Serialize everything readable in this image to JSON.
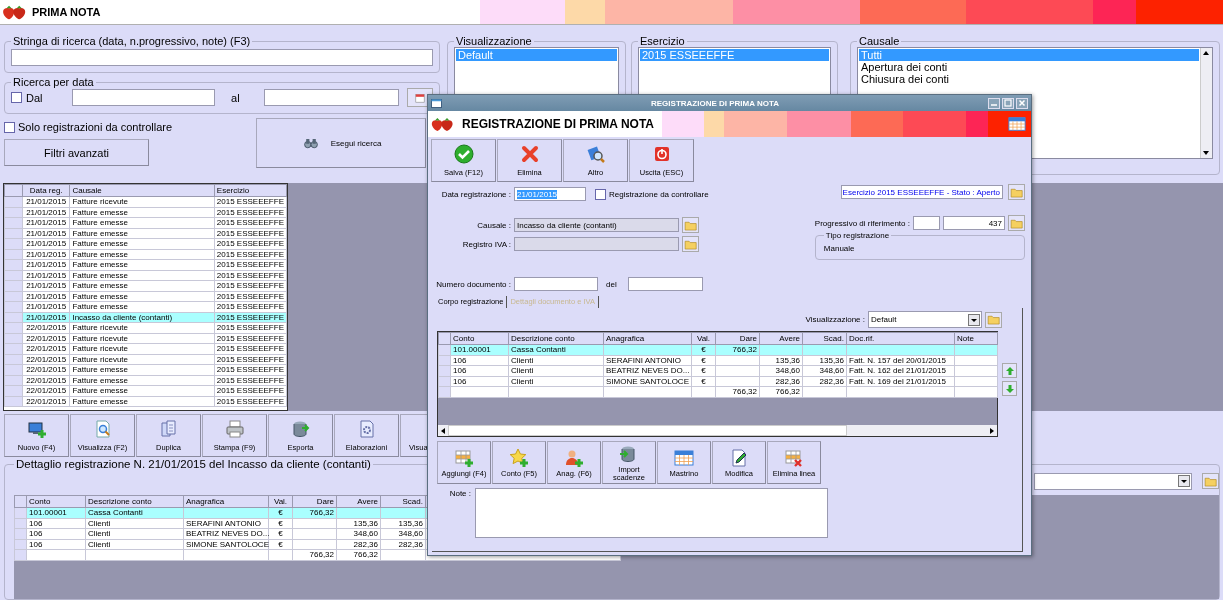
{
  "app": {
    "title": "PRIMA NOTA"
  },
  "search": {
    "legend": "Stringa di ricerca (data, n.progressivo, note) (F3)"
  },
  "date_search": {
    "legend": "Ricerca per data",
    "from_label": "Dal",
    "from_checked": false,
    "to_label": "al"
  },
  "only_to_check": {
    "label": "Solo registrazioni da controllare",
    "checked": false
  },
  "advanced_filters_button": "Filtri avanzati",
  "run_search_button": "Esegui ricerca",
  "view_list": {
    "legend": "Visualizzazione",
    "items": [
      {
        "label": "Default",
        "selected": true
      }
    ]
  },
  "year_list": {
    "legend": "Esercizio",
    "items": [
      {
        "label": "2015 ESSEEEFFE",
        "selected": true
      }
    ]
  },
  "reason_list": {
    "legend": "Causale",
    "items": [
      {
        "label": "Tutti",
        "selected": true
      },
      {
        "label": "Apertura dei conti",
        "selected": false
      },
      {
        "label": "Chiusura dei conti",
        "selected": false
      }
    ]
  },
  "registrations": {
    "columns": [
      "Data reg.",
      "Causale",
      "Esercizio"
    ],
    "rows": [
      {
        "cells": [
          "21/01/2015",
          "Fatture ricevute",
          "2015 ESSEEEFFE"
        ],
        "selected": false
      },
      {
        "cells": [
          "21/01/2015",
          "Fatture emesse",
          "2015 ESSEEEFFE"
        ],
        "selected": false
      },
      {
        "cells": [
          "21/01/2015",
          "Fatture emesse",
          "2015 ESSEEEFFE"
        ],
        "selected": false
      },
      {
        "cells": [
          "21/01/2015",
          "Fatture emesse",
          "2015 ESSEEEFFE"
        ],
        "selected": false
      },
      {
        "cells": [
          "21/01/2015",
          "Fatture emesse",
          "2015 ESSEEEFFE"
        ],
        "selected": false
      },
      {
        "cells": [
          "21/01/2015",
          "Fatture emesse",
          "2015 ESSEEEFFE"
        ],
        "selected": false
      },
      {
        "cells": [
          "21/01/2015",
          "Fatture emesse",
          "2015 ESSEEEFFE"
        ],
        "selected": false
      },
      {
        "cells": [
          "21/01/2015",
          "Fatture emesse",
          "2015 ESSEEEFFE"
        ],
        "selected": false
      },
      {
        "cells": [
          "21/01/2015",
          "Fatture emesse",
          "2015 ESSEEEFFE"
        ],
        "selected": false
      },
      {
        "cells": [
          "21/01/2015",
          "Fatture emesse",
          "2015 ESSEEEFFE"
        ],
        "selected": false
      },
      {
        "cells": [
          "21/01/2015",
          "Fatture emesse",
          "2015 ESSEEEFFE"
        ],
        "selected": false
      },
      {
        "cells": [
          "21/01/2015",
          "Incasso da cliente (contanti)",
          "2015 ESSEEEFFE"
        ],
        "selected": true
      },
      {
        "cells": [
          "22/01/2015",
          "Fatture ricevute",
          "2015 ESSEEEFFE"
        ],
        "selected": false
      },
      {
        "cells": [
          "22/01/2015",
          "Fatture ricevute",
          "2015 ESSEEEFFE"
        ],
        "selected": false
      },
      {
        "cells": [
          "22/01/2015",
          "Fatture ricevute",
          "2015 ESSEEEFFE"
        ],
        "selected": false
      },
      {
        "cells": [
          "22/01/2015",
          "Fatture ricevute",
          "2015 ESSEEEFFE"
        ],
        "selected": false
      },
      {
        "cells": [
          "22/01/2015",
          "Fatture emesse",
          "2015 ESSEEEFFE"
        ],
        "selected": false
      },
      {
        "cells": [
          "22/01/2015",
          "Fatture emesse",
          "2015 ESSEEEFFE"
        ],
        "selected": false
      },
      {
        "cells": [
          "22/01/2015",
          "Fatture emesse",
          "2015 ESSEEEFFE"
        ],
        "selected": false
      },
      {
        "cells": [
          "22/01/2015",
          "Fatture emesse",
          "2015 ESSEEEFFE"
        ],
        "selected": false
      }
    ]
  },
  "toolbar": [
    "Nuovo (F4)",
    "Visualizza (F2)",
    "Duplica",
    "Stampa (F9)",
    "Esporta",
    "Elaborazioni",
    "Visua"
  ],
  "detail": {
    "legend": "Dettaglio registrazione N. 21/01/2015 del Incasso da cliente (contanti)",
    "columns": [
      "Conto",
      "Descrizione conto",
      "Anagrafica",
      "Val.",
      "Dare",
      "Avere",
      "Scad."
    ],
    "rows": [
      {
        "cells": [
          "101.00001",
          "Cassa Contanti",
          null,
          "€",
          "766,32",
          null,
          null
        ],
        "selected": true
      },
      {
        "cells": [
          "106",
          "Clienti",
          "SERAFINI ANTONIO",
          "€",
          null,
          "135,36",
          "135,36"
        ],
        "selected": false
      },
      {
        "cells": [
          "106",
          "Clienti",
          "BEATRIZ NEVES DO...",
          "€",
          null,
          "348,60",
          "348,60"
        ],
        "selected": false
      },
      {
        "cells": [
          "106",
          "Clienti",
          "SIMONE SANTOLOCE",
          "€",
          null,
          "282,36",
          "282,36"
        ],
        "selected": false
      },
      {
        "cells": [
          null,
          null,
          null,
          null,
          "766,32",
          "766,32",
          null
        ],
        "selected": false
      }
    ]
  },
  "dialog": {
    "window_title": "REGISTRAZIONE DI PRIMA NOTA",
    "header_title": "REGISTRAZIONE DI PRIMA NOTA",
    "actions": [
      "Salva (F12)",
      "Elimina",
      "Altro",
      "Uscita (ESC)"
    ],
    "date": {
      "label": "Data registrazione :",
      "value": "21/01/2015"
    },
    "to_check": {
      "label": "Registrazione da controllare",
      "checked": false
    },
    "year_status": "Esercizio 2015 ESSEEEFFE - Stato : Aperto",
    "causale": {
      "label": "Causale :",
      "value": "Incasso da cliente (contanti)"
    },
    "vat_register": {
      "label": "Registro IVA :"
    },
    "progressive": {
      "label": "Progressivo di riferimento :",
      "value": "437"
    },
    "reg_type": {
      "legend": "Tipo registrazione",
      "value": "Manuale"
    },
    "doc_number": {
      "label": "Numero documento :",
      "date_label": "del"
    },
    "tabs": [
      {
        "label": "Corpo registrazione",
        "selected": true
      },
      {
        "label": "Dettagli documento e IVA",
        "selected": false
      }
    ],
    "view": {
      "label": "Visualizzazione :",
      "value": "Default"
    },
    "columns": [
      "Conto",
      "Descrizione conto",
      "Anagrafica",
      "Val.",
      "Dare",
      "Avere",
      "Scad.",
      "Doc.rif.",
      "Note"
    ],
    "rows": [
      {
        "cells": [
          "101.00001",
          "Cassa Contanti",
          null,
          "€",
          "766,32",
          null,
          null,
          null,
          null
        ],
        "selected": true
      },
      {
        "cells": [
          "106",
          "Clienti",
          "SERAFINI ANTONIO",
          "€",
          null,
          "135,36",
          "135,36",
          "Fatt. N. 157 del 20/01/2015",
          null
        ],
        "selected": false
      },
      {
        "cells": [
          "106",
          "Clienti",
          "BEATRIZ NEVES DO...",
          "€",
          null,
          "348,60",
          "348,60",
          "Fatt. N. 162 del 21/01/2015",
          null
        ],
        "selected": false
      },
      {
        "cells": [
          "106",
          "Clienti",
          "SIMONE SANTOLOCE",
          "€",
          null,
          "282,36",
          "282,36",
          "Fatt. N. 169 del 21/01/2015",
          null
        ],
        "selected": false
      },
      {
        "cells": [
          null,
          null,
          null,
          null,
          "766,32",
          "766,32",
          null,
          null,
          null
        ],
        "selected": false
      }
    ],
    "line_buttons": [
      "Aggiungi (F4)",
      "Conto (F5)",
      "Anag. (F6)",
      "Import scadenze",
      "Mastrino",
      "Modifica",
      "Elimina linea"
    ],
    "note_label": "Note :"
  }
}
